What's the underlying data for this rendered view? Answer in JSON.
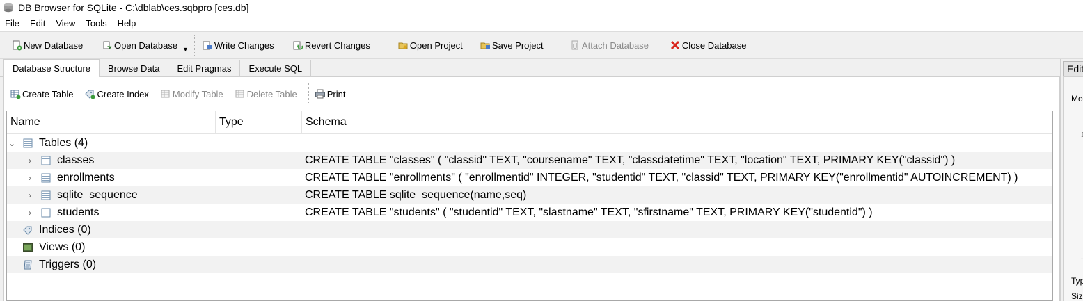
{
  "window": {
    "title": "DB Browser for SQLite - C:\\dblab\\ces.sqbpro [ces.db]"
  },
  "menu": [
    "File",
    "Edit",
    "View",
    "Tools",
    "Help"
  ],
  "toolbar": {
    "new_database": "New Database",
    "open_database": "Open Database",
    "write_changes": "Write Changes",
    "revert_changes": "Revert Changes",
    "open_project": "Open Project",
    "save_project": "Save Project",
    "attach_database": "Attach Database",
    "close_database": "Close Database"
  },
  "tabs": [
    "Database Structure",
    "Browse Data",
    "Edit Pragmas",
    "Execute SQL"
  ],
  "structure_toolbar": {
    "create_table": "Create Table",
    "create_index": "Create Index",
    "modify_table": "Modify Table",
    "delete_table": "Delete Table",
    "print": "Print"
  },
  "tree": {
    "headers": {
      "name": "Name",
      "type": "Type",
      "schema": "Schema"
    },
    "tables_group": "Tables (4)",
    "tables": [
      {
        "name": "classes",
        "schema": "CREATE TABLE \"classes\" ( \"classid\" TEXT, \"coursename\" TEXT, \"classdatetime\" TEXT, \"location\" TEXT, PRIMARY KEY(\"classid\") )"
      },
      {
        "name": "enrollments",
        "schema": "CREATE TABLE \"enrollments\" ( \"enrollmentid\" INTEGER, \"studentid\" TEXT, \"classid\" TEXT, PRIMARY KEY(\"enrollmentid\" AUTOINCREMENT) )"
      },
      {
        "name": "sqlite_sequence",
        "schema": "CREATE TABLE sqlite_sequence(name,seq)"
      },
      {
        "name": "students",
        "schema": "CREATE TABLE \"students\" ( \"studentid\" TEXT, \"slastname\" TEXT, \"sfirstname\" TEXT, PRIMARY KEY(\"studentid\") )"
      }
    ],
    "indices_group": "Indices (0)",
    "views_group": "Views (0)",
    "triggers_group": "Triggers (0)"
  },
  "right_panel": {
    "tab_label": "Edit",
    "label_mode": "Mo",
    "label_type": "Typ",
    "label_size": "Siz",
    "mark_1": "1",
    "mark_dash": "–"
  },
  "colors": {
    "window_bg": "#f0f0f0",
    "alt_row": "#f2f2f2",
    "disabled_text": "#8a8a8a",
    "close_red": "#d9241c"
  }
}
